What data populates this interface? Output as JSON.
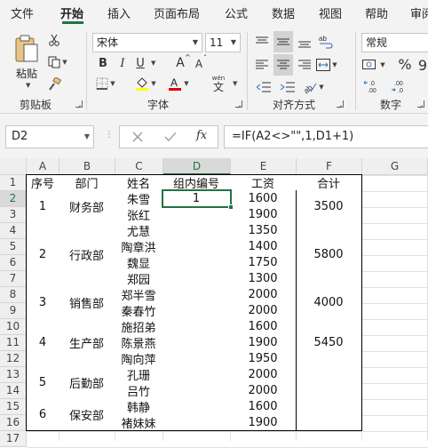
{
  "menu": {
    "tabs": [
      "文件",
      "开始",
      "插入",
      "页面布局",
      "公式",
      "数据",
      "视图",
      "帮助",
      "审阅"
    ],
    "active_tab": "开始"
  },
  "ribbon": {
    "clipboard": {
      "label": "剪贴板",
      "paste_label": "粘贴"
    },
    "font": {
      "label": "字体",
      "font_name": "宋体",
      "font_size": "11",
      "bold": "B",
      "italic": "I",
      "underline": "U",
      "grow": "A",
      "shrink": "A",
      "phonetic": "wén",
      "phonetic_char": "文"
    },
    "alignment": {
      "label": "对齐方式"
    },
    "number": {
      "label": "数字",
      "format": "常规",
      "percent": "%"
    }
  },
  "formula_bar": {
    "name_box": "D2",
    "fx": "fx",
    "formula": "=IF(A2<>\"\",1,D1+1)"
  },
  "sheet": {
    "columns": [
      "A",
      "B",
      "C",
      "D",
      "E",
      "F",
      "G"
    ],
    "rows": [
      "1",
      "2",
      "3",
      "4",
      "5",
      "6",
      "7",
      "8",
      "9",
      "10",
      "11",
      "12",
      "13",
      "14",
      "15",
      "16",
      "17"
    ],
    "selected_cell": "D2",
    "header": {
      "A": "序号",
      "B": "部门",
      "C": "姓名",
      "D": "组内编号",
      "E": "工资",
      "F": "合计"
    },
    "groups": [
      {
        "seq": "1",
        "dept": "财务部",
        "total": "3500"
      },
      {
        "seq": "2",
        "dept": "行政部",
        "total": "5800"
      },
      {
        "seq": "3",
        "dept": "销售部",
        "total": "4000"
      },
      {
        "seq": "4",
        "dept": "生产部",
        "total": "5450"
      },
      {
        "seq": "5",
        "dept": "后勤部",
        "total": ""
      },
      {
        "seq": "6",
        "dept": "保安部",
        "total": ""
      }
    ],
    "people": [
      {
        "name": "朱雪",
        "group_no": "1",
        "salary": "1600"
      },
      {
        "name": "张红",
        "group_no": "",
        "salary": "1900"
      },
      {
        "name": "尤慧",
        "group_no": "",
        "salary": "1350"
      },
      {
        "name": "陶章洪",
        "group_no": "",
        "salary": "1400"
      },
      {
        "name": "魏显",
        "group_no": "",
        "salary": "1750"
      },
      {
        "name": "郑园",
        "group_no": "",
        "salary": "1300"
      },
      {
        "name": "郑半雪",
        "group_no": "",
        "salary": "2000"
      },
      {
        "name": "秦春竹",
        "group_no": "",
        "salary": "2000"
      },
      {
        "name": "施招弟",
        "group_no": "",
        "salary": "1600"
      },
      {
        "name": "陈景燕",
        "group_no": "",
        "salary": "1900"
      },
      {
        "name": "陶向萍",
        "group_no": "",
        "salary": "1950"
      },
      {
        "name": "孔珊",
        "group_no": "",
        "salary": "2000"
      },
      {
        "name": "吕竹",
        "group_no": "",
        "salary": "2000"
      },
      {
        "name": "韩静",
        "group_no": "",
        "salary": "1600"
      },
      {
        "name": "褚妹妹",
        "group_no": "",
        "salary": "1900"
      }
    ]
  }
}
